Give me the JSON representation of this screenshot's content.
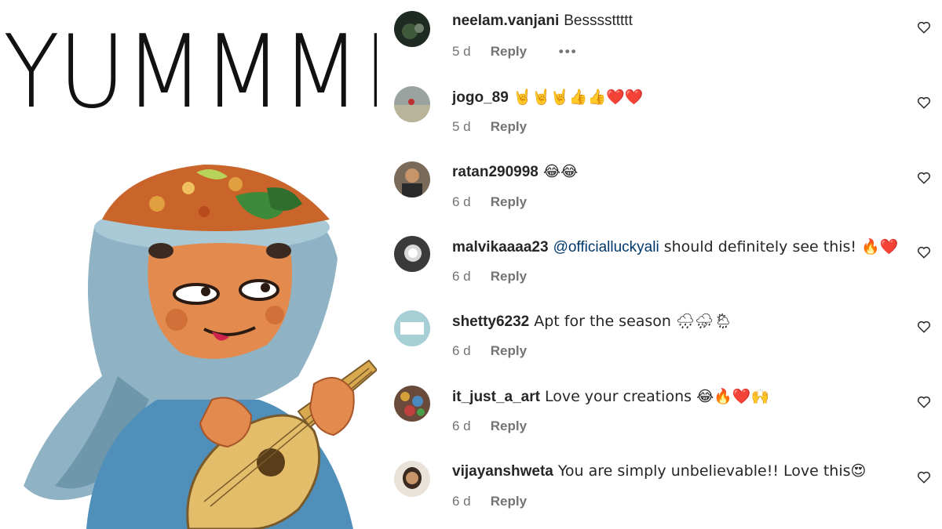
{
  "image": {
    "headline": "YUMMMMMM"
  },
  "comments": [
    {
      "username": "neelam.vanjani",
      "text": "Bessssttttt",
      "time": "5 d",
      "reply": "Reply",
      "more": "•••",
      "avatar": "avatar-icon"
    },
    {
      "username": "jogo_89",
      "text": "🤘🤘🤘👍👍❤️❤️",
      "time": "5 d",
      "reply": "Reply",
      "avatar": "avatar-icon"
    },
    {
      "username": "ratan290998",
      "text": "😂😂",
      "time": "6 d",
      "reply": "Reply",
      "avatar": "avatar-icon"
    },
    {
      "username": "malvikaaaa23",
      "mention": "@officialluckyali",
      "text": " should definitely see this! 🔥❤️",
      "time": "6 d",
      "reply": "Reply",
      "avatar": "avatar-icon"
    },
    {
      "username": "shetty6232",
      "text": "Apt for the season 🌧⛈🌦",
      "time": "6 d",
      "reply": "Reply",
      "avatar": "avatar-icon"
    },
    {
      "username": "it_just_a_art",
      "text": "Love your creations 😂🔥❤️🙌",
      "time": "6 d",
      "reply": "Reply",
      "avatar": "avatar-icon"
    },
    {
      "username": "vijayanshweta",
      "text": "You are simply unbelievable!! Love this😍",
      "time": "6 d",
      "reply": "Reply",
      "avatar": "avatar-icon"
    }
  ],
  "colors": {
    "text": "#262626",
    "meta": "#737373",
    "mention": "#00376b",
    "scarf": "#8fb3c4",
    "skin": "#e38a4f"
  }
}
